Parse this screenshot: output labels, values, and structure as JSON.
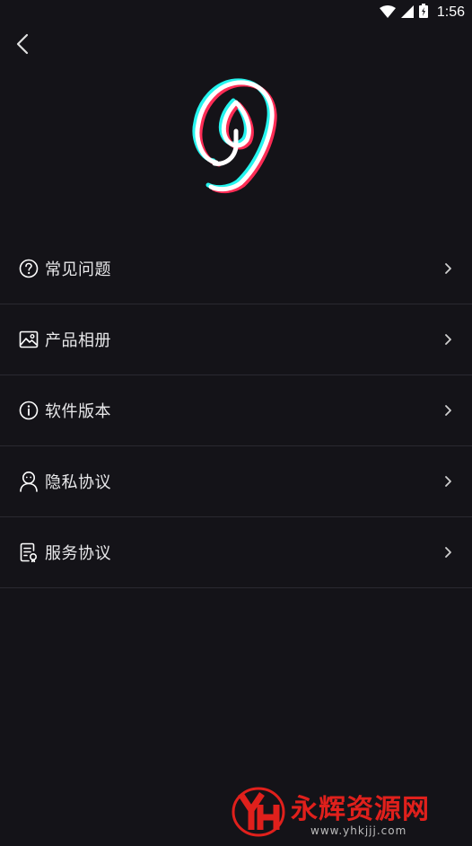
{
  "status_bar": {
    "time": "1:56",
    "icons": [
      "wifi-icon",
      "signal-icon",
      "battery-icon"
    ]
  },
  "header": {
    "back_icon": "chevron-left-icon"
  },
  "logo": {
    "icon": "app-logo-icon",
    "colors": {
      "main": "#ffffff",
      "cyan": "#25f4ee",
      "red": "#fe2c55"
    }
  },
  "menu": {
    "items": [
      {
        "label": "常见问题",
        "icon": "help-circle-icon"
      },
      {
        "label": "产品相册",
        "icon": "image-icon"
      },
      {
        "label": "软件版本",
        "icon": "info-circle-icon"
      },
      {
        "label": "隐私协议",
        "icon": "user-icon"
      },
      {
        "label": "服务协议",
        "icon": "document-icon"
      }
    ]
  },
  "watermark": {
    "text": "永辉资源网",
    "url": "www.yhkjjj.com",
    "color": "#e0201c"
  }
}
